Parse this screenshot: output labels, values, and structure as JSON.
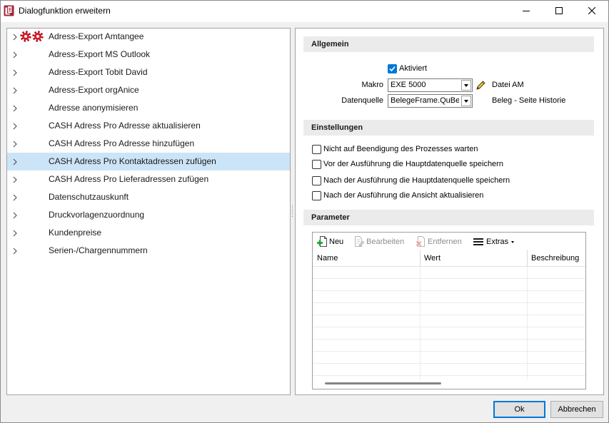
{
  "window": {
    "title": "Dialogfunktion erweitern",
    "icon": "app-icon",
    "controls": [
      "minimize-icon",
      "maximize-icon",
      "close-icon"
    ]
  },
  "tree": {
    "selected_index": 7,
    "items": [
      {
        "label": "Adress-Export Amtangee",
        "icons": [
          "gear-icon",
          "gear-icon"
        ]
      },
      {
        "label": "Adress-Export MS Outlook"
      },
      {
        "label": "Adress-Export Tobit David"
      },
      {
        "label": "Adress-Export orgAnice"
      },
      {
        "label": "Adresse anonymisieren"
      },
      {
        "label": "CASH Adress Pro Adresse aktualisieren"
      },
      {
        "label": "CASH Adress Pro Adresse hinzufügen"
      },
      {
        "label": "CASH Adress Pro Kontaktadressen zufügen"
      },
      {
        "label": "CASH Adress Pro Lieferadressen zufügen"
      },
      {
        "label": "Datenschutzauskunft"
      },
      {
        "label": "Druckvorlagenzuordnung"
      },
      {
        "label": "Kundenpreise"
      },
      {
        "label": "Serien-/Chargennummern"
      }
    ]
  },
  "general": {
    "header": "Allgemein",
    "activated": {
      "label": "Aktiviert",
      "checked": true
    },
    "macro": {
      "label": "Makro",
      "value": "EXE 5000",
      "note": "Datei AM",
      "edit_icon": "pencil-icon"
    },
    "datasource": {
      "label": "Datenquelle",
      "value": "BelegeFrame.QuBel",
      "note": "Beleg - Seite Historie"
    }
  },
  "settings": {
    "header": "Einstellungen",
    "options": [
      {
        "label": "Nicht auf Beendigung des Prozesses warten",
        "checked": false
      },
      {
        "label": "Vor der Ausführung die Hauptdatenquelle speichern",
        "checked": false
      },
      {
        "label": "Nach der Ausführung die Hauptdatenquelle speichern",
        "checked": false
      },
      {
        "label": "Nach der Ausführung die Ansicht aktualisieren",
        "checked": false
      }
    ]
  },
  "parameters": {
    "header": "Parameter",
    "toolbar": {
      "new": {
        "label": "Neu",
        "icon": "add-document-icon",
        "enabled": true
      },
      "edit": {
        "label": "Bearbeiten",
        "icon": "edit-document-icon",
        "enabled": false
      },
      "remove": {
        "label": "Entfernen",
        "icon": "delete-document-icon",
        "enabled": false
      },
      "extras": {
        "label": "Extras",
        "icon": "menu-icon",
        "enabled": true
      }
    },
    "columns": [
      "Name",
      "Wert",
      "Beschreibung"
    ],
    "rows": []
  },
  "footer": {
    "ok": "Ok",
    "cancel": "Abbrechen"
  },
  "theme": {
    "accent": "#0078d7",
    "selection": "#cce4f7",
    "section_header_bg": "#ebebeb",
    "gear": "#d21f2b"
  }
}
